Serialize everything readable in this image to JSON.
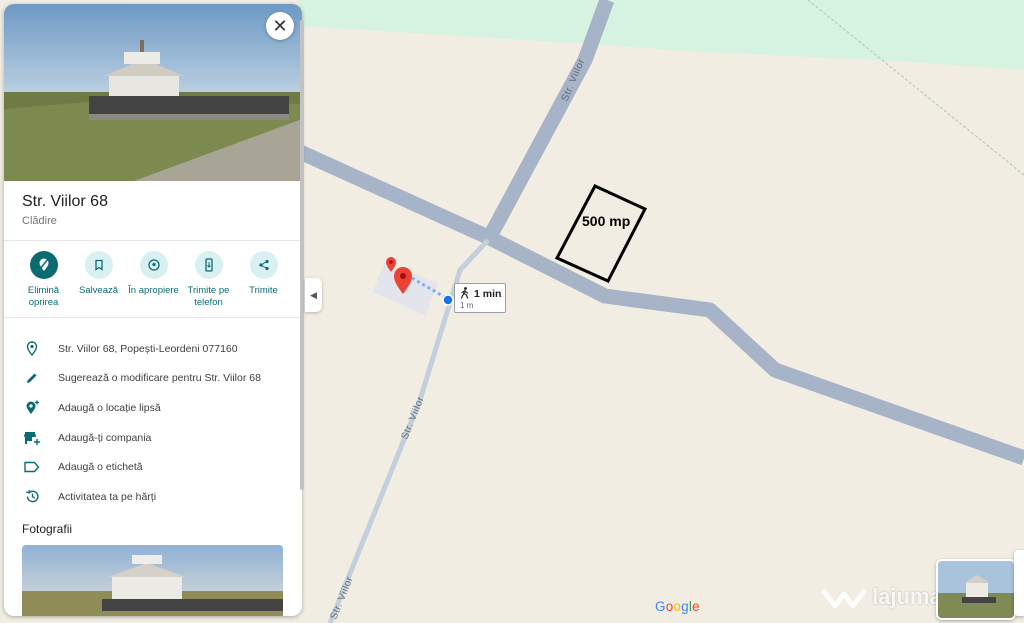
{
  "colors": {
    "land": "#f1ede3",
    "park": "#d6f2e0",
    "road": "#a7b4c8",
    "accent": "#0b6b73",
    "marker_red": "#ea4335",
    "route_dot": "#1a73e8"
  },
  "map": {
    "street_labels": [
      "Str. Viilor",
      "Str. Viilor",
      "Str. Viilor"
    ],
    "plot_label": "500 mp",
    "route_chip": {
      "icon": "walk-icon",
      "time": "1 min",
      "distance": "1 m"
    },
    "google_logo": [
      "G",
      "o",
      "o",
      "g",
      "l",
      "e"
    ],
    "watermark": "lajumate.ro"
  },
  "place": {
    "title": "Str. Viilor 68",
    "category": "Clădire",
    "close_icon": "close-icon"
  },
  "actions": [
    {
      "label": "Elimină oprirea",
      "icon": "remove-stop-icon"
    },
    {
      "label": "Salvează",
      "icon": "bookmark-icon"
    },
    {
      "label": "În apropiere",
      "icon": "nearby-icon"
    },
    {
      "label": "Trimite pe telefon",
      "icon": "send-to-phone-icon"
    },
    {
      "label": "Trimite",
      "icon": "share-icon"
    }
  ],
  "info_rows": [
    {
      "text": "Str. Viilor 68, Popești-Leordeni 077160",
      "icon": "location-pin-icon"
    },
    {
      "text": "Sugerează o modificare pentru Str. Viilor 68",
      "icon": "pencil-icon"
    },
    {
      "text": "Adaugă o locație lipsă",
      "icon": "add-location-icon"
    },
    {
      "text": "Adaugă-ți compania",
      "icon": "add-business-icon"
    },
    {
      "text": "Adaugă o etichetă",
      "icon": "label-icon"
    },
    {
      "text": "Activitatea ta pe hărți",
      "icon": "history-icon"
    }
  ],
  "photos": {
    "heading": "Fotografii"
  },
  "collapse_icon": "chevron-left-icon"
}
